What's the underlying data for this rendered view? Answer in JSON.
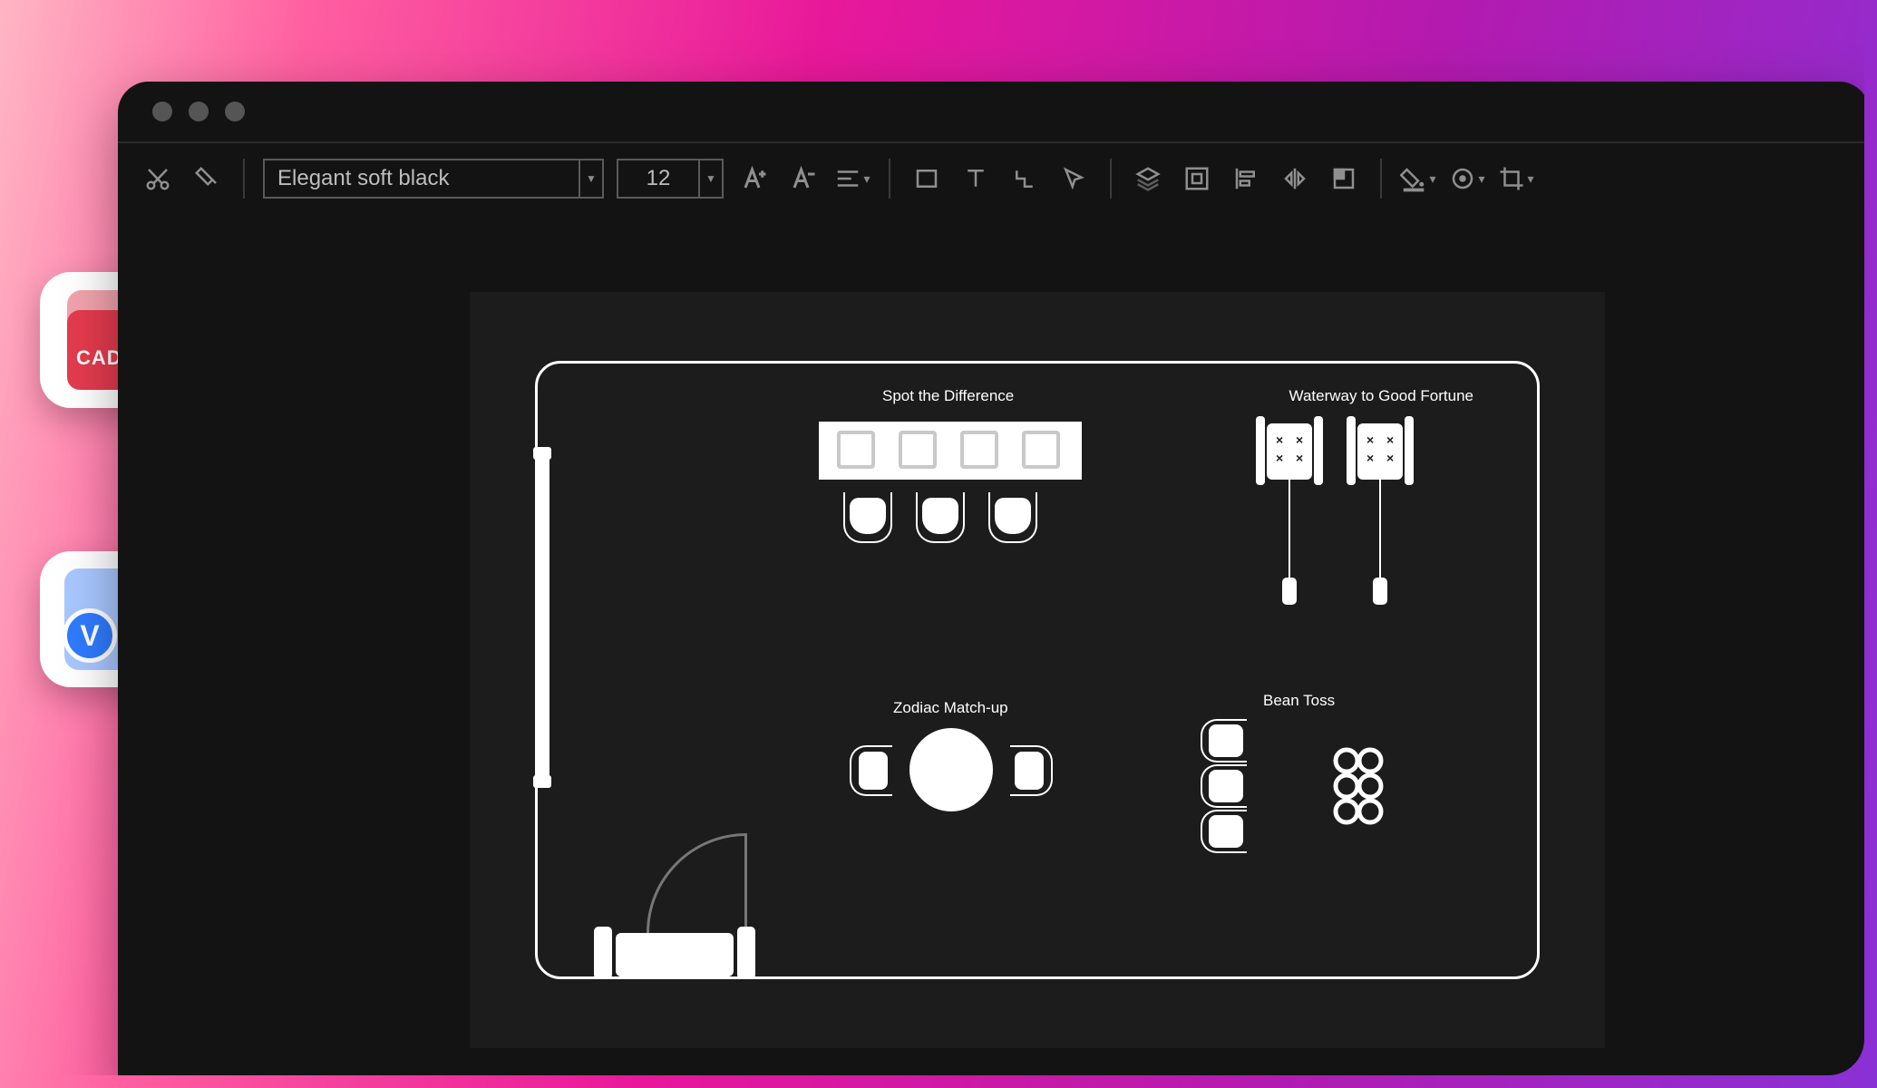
{
  "toolbar": {
    "font_name": "Elegant soft black",
    "font_size": "12"
  },
  "floorplan": {
    "labels": {
      "spot": "Spot the Difference",
      "waterway": "Waterway to Good Fortune",
      "zodiac": "Zodiac Match-up",
      "bean": "Bean Toss"
    }
  },
  "badges": {
    "cad": "CAD",
    "visio": "V"
  },
  "icons": {
    "cut": "cut",
    "paint": "paint-format",
    "font_inc": "A+",
    "font_dec": "A-",
    "align": "align",
    "rect": "rectangle",
    "text": "text",
    "connector": "connector",
    "pointer": "pointer",
    "layers": "layers",
    "group": "group",
    "align_left": "align-left",
    "flip": "flip",
    "position": "position",
    "fill": "fill-color",
    "stroke": "stroke-color",
    "crop": "crop"
  }
}
